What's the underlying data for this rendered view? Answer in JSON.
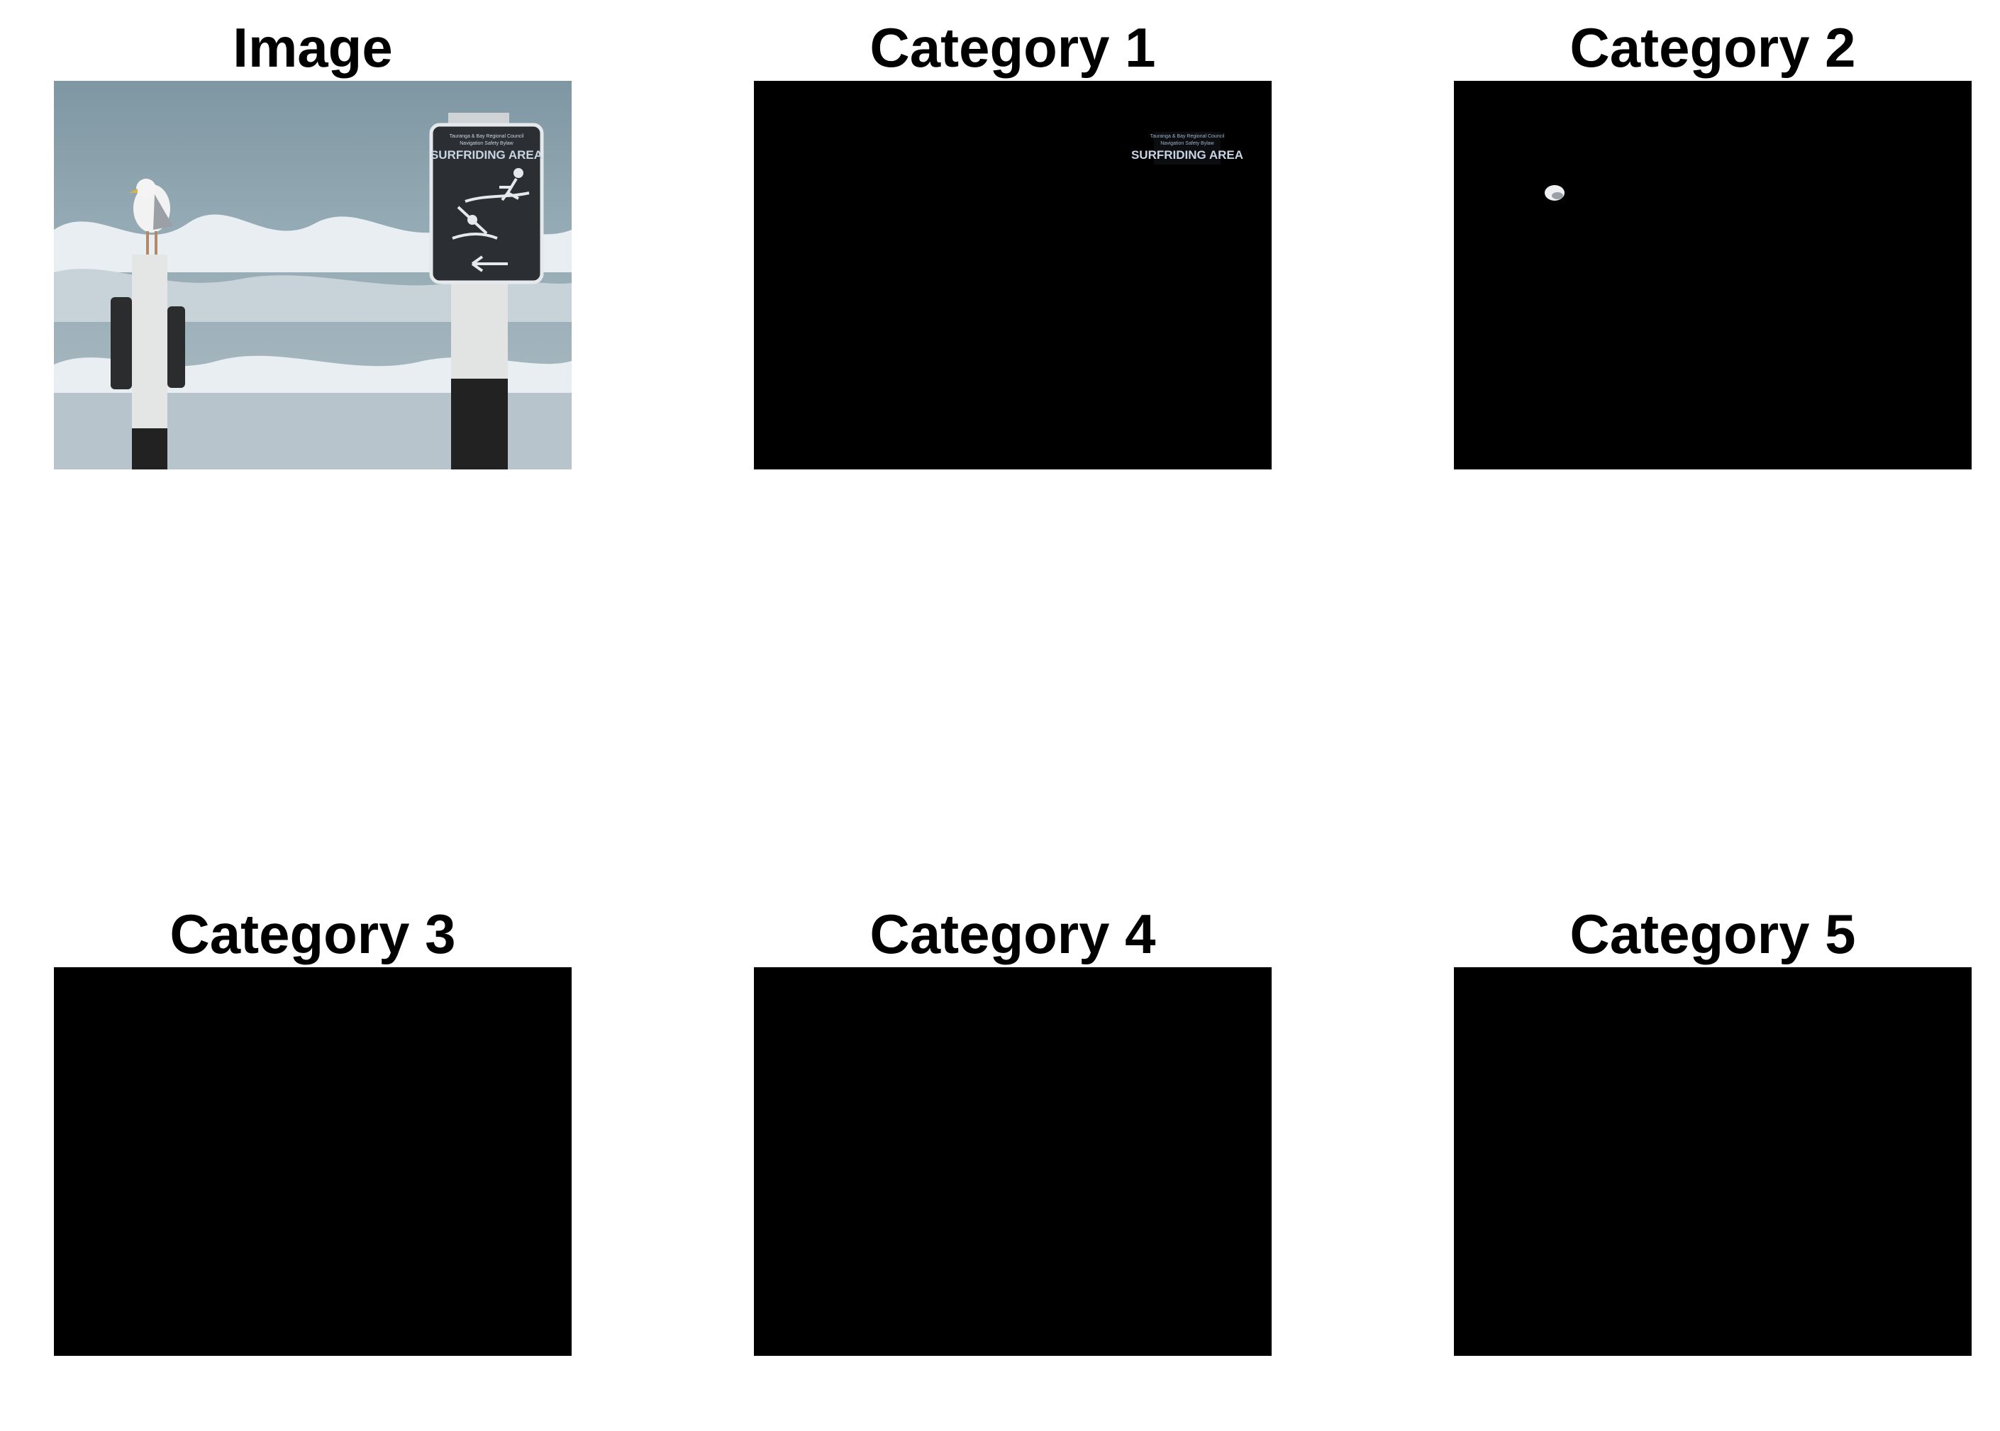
{
  "panels": [
    {
      "title": "Image",
      "kind": "photo"
    },
    {
      "title": "Category 1",
      "kind": "mask-sign"
    },
    {
      "title": "Category 2",
      "kind": "mask-bird"
    },
    {
      "title": "Category 3",
      "kind": "mask-empty"
    },
    {
      "title": "Category 4",
      "kind": "mask-empty"
    },
    {
      "title": "Category 5",
      "kind": "mask-empty"
    }
  ],
  "sign_text": {
    "line1": "Tauranga & Bay Regional Council",
    "line2": "Navigation Safety Bylaw",
    "heading": "SURFRIDING AREA"
  },
  "colors": {
    "background": "#ffffff",
    "mask": "#000000",
    "sea": "#8fa3ad",
    "foam": "#e8eef1",
    "sign": "#2b2f33",
    "sign_text": "#c9d4e2"
  }
}
